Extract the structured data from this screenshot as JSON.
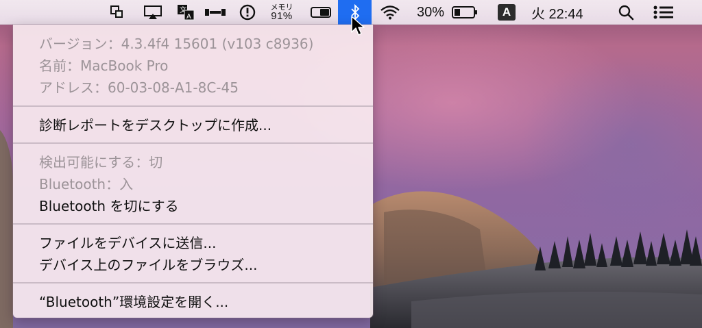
{
  "menubar": {
    "memory_label": "メモリ",
    "memory_value": "91%",
    "battery_percent_text": "30%",
    "battery_level": 0.3,
    "input_source": "A",
    "clock": "火 22:44",
    "active_highlight": "#1f6df1"
  },
  "bluetooth_menu": {
    "info": {
      "version": "バージョン：4.3.4f4 15601 (v103 c8936)",
      "name": "名前：MacBook Pro",
      "address": "アドレス：60-03-08-A1-8C-45"
    },
    "diagnostics": "診断レポートをデスクトップに作成...",
    "discoverable": "検出可能にする：切",
    "bluetooth_status": "Bluetooth：入",
    "toggle_bluetooth": "Bluetooth を切にする",
    "send_file": "ファイルをデバイスに送信...",
    "browse_files": "デバイス上のファイルをブラウズ...",
    "open_prefs": "“Bluetooth”環境設定を開く..."
  }
}
